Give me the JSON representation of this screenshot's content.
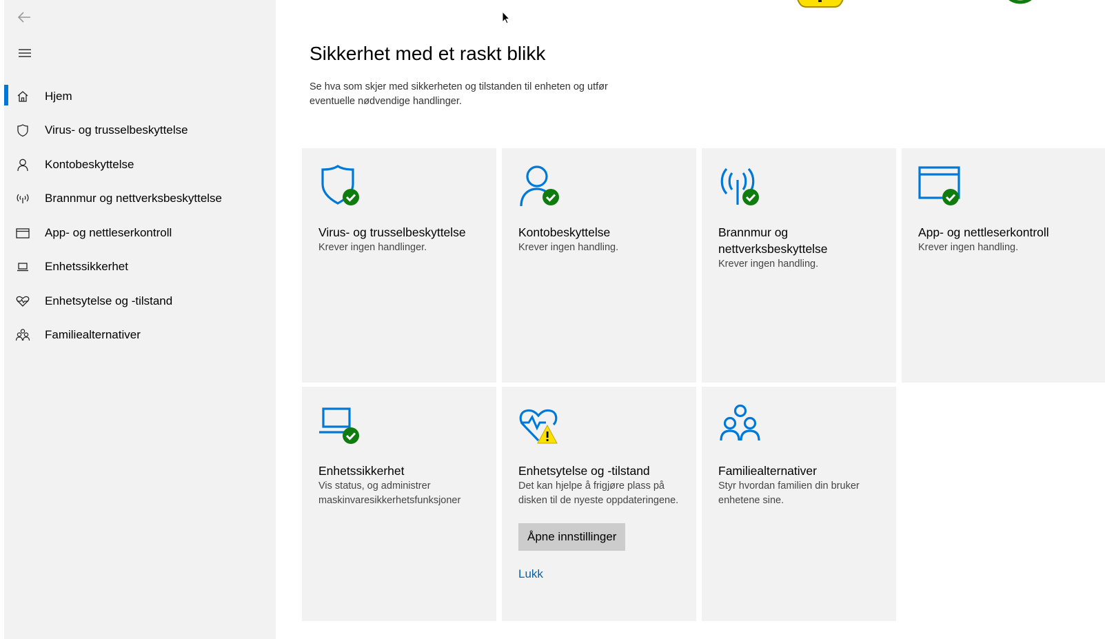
{
  "sidebar": {
    "items": [
      {
        "label": "Hjem",
        "icon": "home-icon",
        "selected": true
      },
      {
        "label": "Virus- og trusselbeskyttelse",
        "icon": "shield-icon"
      },
      {
        "label": "Kontobeskyttelse",
        "icon": "person-icon"
      },
      {
        "label": "Brannmur og nettverksbeskyttelse",
        "icon": "antenna-icon"
      },
      {
        "label": "App- og nettleserkontroll",
        "icon": "browser-window-icon"
      },
      {
        "label": "Enhetssikkerhet",
        "icon": "laptop-icon"
      },
      {
        "label": "Enhetsytelse og -tilstand",
        "icon": "heart-icon"
      },
      {
        "label": "Familiealternativer",
        "icon": "family-icon"
      }
    ]
  },
  "main": {
    "title": "Sikkerhet med et raskt blikk",
    "description": "Se hva som skjer med sikkerheten og tilstanden til enheten og utfør eventuelle nødvendige handlinger.",
    "tiles": [
      {
        "title": "Virus- og trusselbeskyttelse",
        "status": "Krever ingen handlinger.",
        "icon": "shield-check-icon"
      },
      {
        "title": "Kontobeskyttelse",
        "status": "Krever ingen handling.",
        "icon": "person-check-icon"
      },
      {
        "title": "Brannmur og nettverksbeskyttelse",
        "status": "Krever ingen handling.",
        "icon": "antenna-check-icon"
      },
      {
        "title": "App- og nettleserkontroll",
        "status": "Krever ingen handling.",
        "icon": "browser-check-icon"
      },
      {
        "title": "Enhetssikkerhet",
        "status": "Vis status, og administrer maskinvaresikkerhetsfunksjoner",
        "icon": "laptop-check-icon"
      },
      {
        "title": "Enhetsytelse og -tilstand",
        "status": "Det kan hjelpe å frigjøre plass på disken til de nyeste oppdateringene.",
        "icon": "heart-warning-icon",
        "button": "Åpne innstillinger",
        "link": "Lukk"
      },
      {
        "title": "Familiealternativer",
        "status": "Styr hvordan familien din bruker enhetene sine.",
        "icon": "family-icon"
      }
    ]
  },
  "colors": {
    "accent": "#0078d7",
    "ok": "#107c10",
    "warning": "#fce100",
    "link": "#0063b1"
  }
}
